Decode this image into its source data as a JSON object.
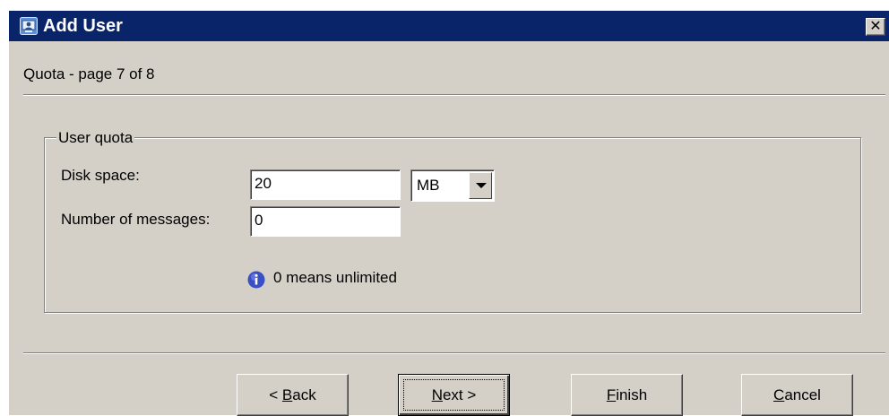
{
  "window": {
    "title": "Add User",
    "close_glyph": "✕"
  },
  "page": {
    "heading": "Quota - page 7 of 8"
  },
  "group": {
    "legend": "User quota",
    "disk_space": {
      "label": "Disk space:",
      "value": "20",
      "unit": "MB"
    },
    "messages": {
      "label": "Number of messages:",
      "value": "0"
    },
    "info": {
      "icon": "info-icon",
      "text": "0 means unlimited"
    }
  },
  "buttons": {
    "back": {
      "prefix": "< ",
      "mnemonic": "B",
      "rest": "ack"
    },
    "next": {
      "mnemonic": "N",
      "rest": "ext >"
    },
    "finish": {
      "mnemonic": "F",
      "rest": "inish"
    },
    "cancel": {
      "mnemonic": "C",
      "rest": "ancel"
    }
  },
  "colors": {
    "titlebar": "#0a246a",
    "dialog_face": "#d4d0c8",
    "info_blue": "#3a4fc4"
  }
}
